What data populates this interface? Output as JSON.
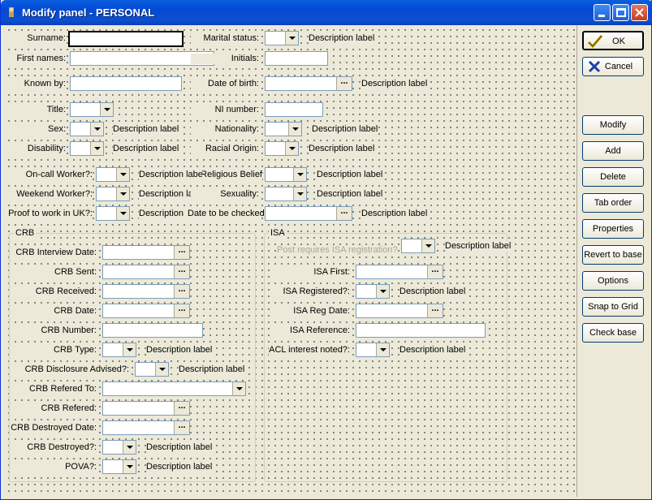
{
  "window": {
    "title": "Modify panel - PERSONAL"
  },
  "personal": {
    "surname": "Surname:",
    "first_names": "First names:",
    "known_by": "Known by:",
    "title": "Title:",
    "sex": "Sex:",
    "disability": "Disability:",
    "oncall": "On-call Worker?:",
    "weekend": "Weekend Worker?:",
    "proof": "Proof to work in UK?:",
    "marital": "Marital status:",
    "initials": "Initials:",
    "dob": "Date of birth:",
    "ni": "NI number:",
    "nationality": "Nationality:",
    "racial": "Racial Origin:",
    "religious": "Religious Belief:",
    "sexuality": "Sexuality:",
    "date_checked": "Date to be checked:",
    "desc": "Description label",
    "desc_clipped_a": "Description label",
    "desc_clipped_b": "Description"
  },
  "crb": {
    "group": "CRB",
    "interview_date": "CRB Interview Date:",
    "sent": "CRB Sent:",
    "received": "CRB Received:",
    "date": "CRB Date:",
    "number": "CRB Number:",
    "type": "CRB Type:",
    "disclosure": "CRB Disclosure Advised?:",
    "refered_to": "CRB Refered To:",
    "refered": "CRB Refered:",
    "destroyed_date": "CRB Destroyed Date:",
    "destroyed": "CRB Destroyed?:",
    "pova": "POVA?:",
    "desc": "Description label"
  },
  "isa": {
    "group": "ISA",
    "post_requires": "Post requires ISA registration?",
    "first": "ISA First:",
    "registered": "ISA Registered?:",
    "reg_date": "ISA Reg Date:",
    "reference": "ISA Reference:",
    "acl": "ACL interest noted?:",
    "desc": "Description label"
  },
  "buttons": {
    "ok": "OK",
    "cancel": "Cancel",
    "modify": "Modify",
    "add": "Add",
    "delete": "Delete",
    "tab_order": "Tab order",
    "properties": "Properties",
    "revert": "Revert to base",
    "options": "Options",
    "snap": "Snap to Grid",
    "check": "Check base"
  },
  "ellipsis": "..."
}
